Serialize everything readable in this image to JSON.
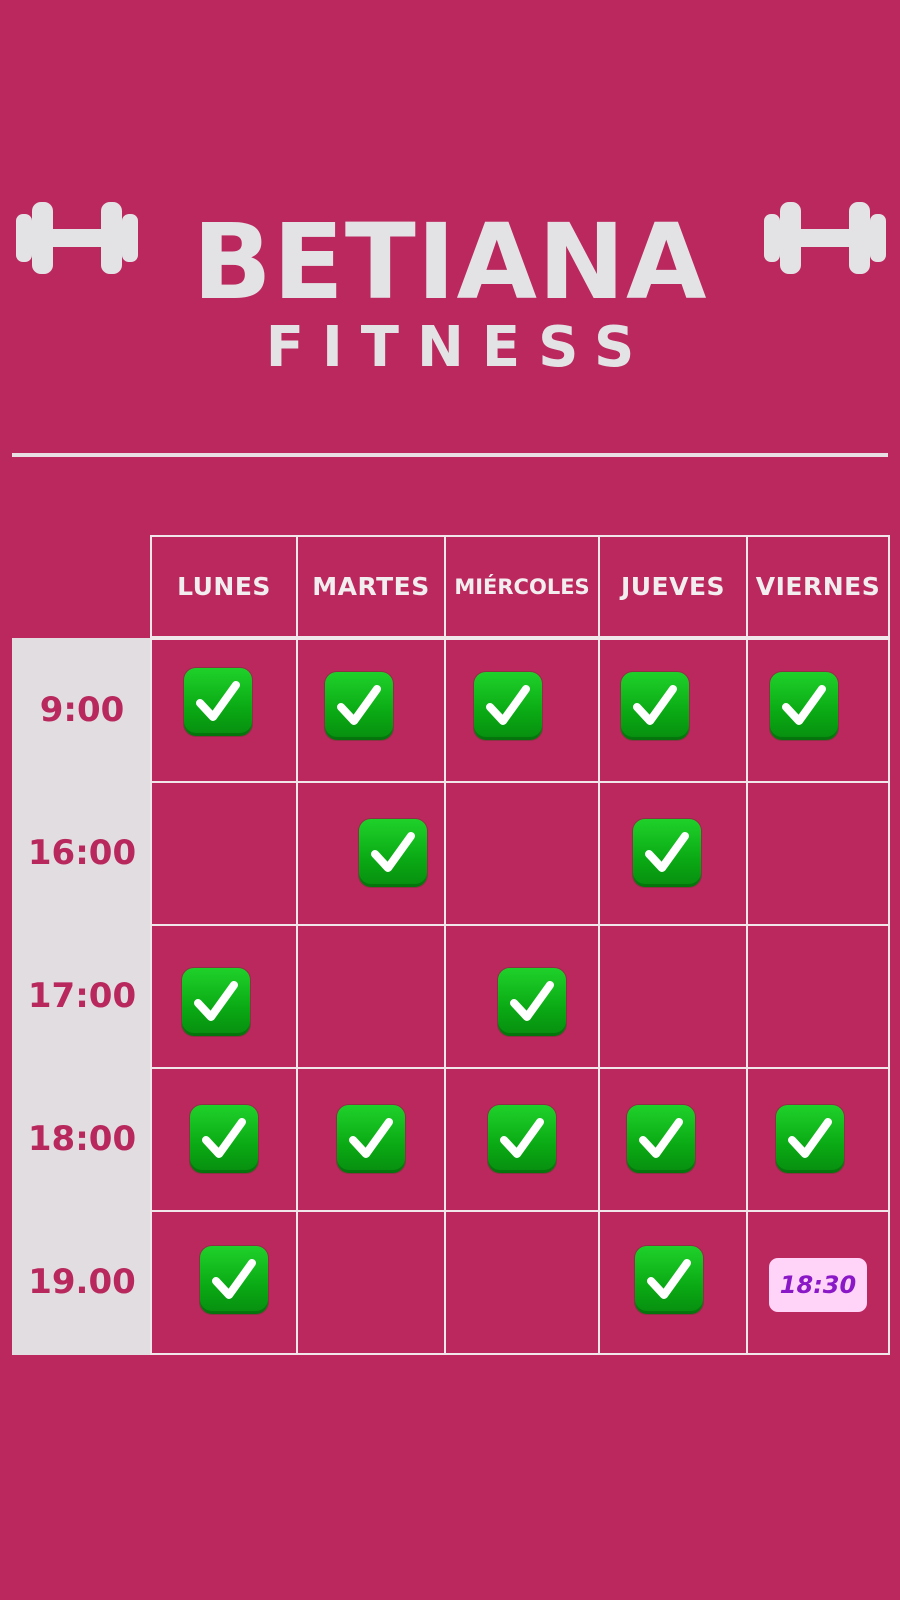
{
  "brand": {
    "title": "BETIANA",
    "subtitle": "FITNESS",
    "icon": "dumbbell-icon"
  },
  "schedule": {
    "days": [
      "LUNES",
      "MARTES",
      "MIÉRCOLES",
      "JUEVES",
      "VIERNES"
    ],
    "times": [
      "9:00",
      "16:00",
      "17:00",
      "18:00",
      "19.00"
    ],
    "checks": [
      [
        true,
        true,
        true,
        true,
        true
      ],
      [
        false,
        true,
        false,
        true,
        false
      ],
      [
        true,
        false,
        true,
        false,
        false
      ],
      [
        true,
        true,
        true,
        true,
        true
      ],
      [
        true,
        false,
        false,
        true,
        false
      ]
    ],
    "check_icon": "check-mark-icon",
    "note": {
      "text": "18:30"
    }
  },
  "colors": {
    "background": "#bb285d",
    "text_light": "#e3e3e6",
    "time_column": "#e2dde1",
    "time_text": "#b8285c",
    "check_green": "#0aa914",
    "badge_bg": "#ffd4f8",
    "badge_text": "#8a18c7"
  }
}
